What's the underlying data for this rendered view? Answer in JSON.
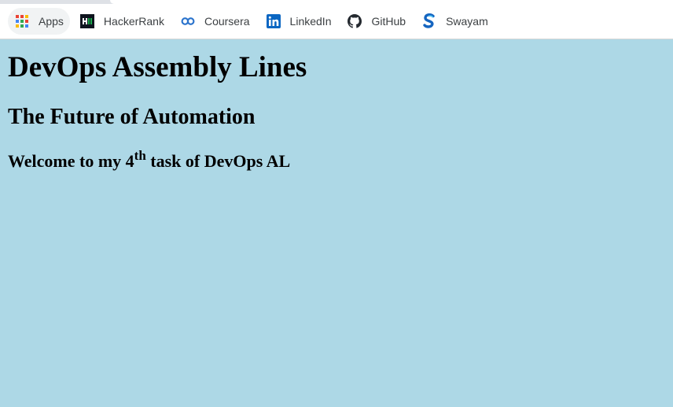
{
  "bookmarks": [
    {
      "label": "Apps",
      "icon": "apps-grid-icon"
    },
    {
      "label": "HackerRank",
      "icon": "hackerrank-icon"
    },
    {
      "label": "Coursera",
      "icon": "coursera-icon"
    },
    {
      "label": "LinkedIn",
      "icon": "linkedin-icon"
    },
    {
      "label": "GitHub",
      "icon": "github-icon"
    },
    {
      "label": "Swayam",
      "icon": "swayam-icon"
    }
  ],
  "page": {
    "background": "#add8e6",
    "title": "DevOps Assembly Lines",
    "subtitle": "The Future of Automation",
    "welcome_prefix": "Welcome to my 4",
    "welcome_sup": "th",
    "welcome_suffix": " task of DevOps AL"
  }
}
